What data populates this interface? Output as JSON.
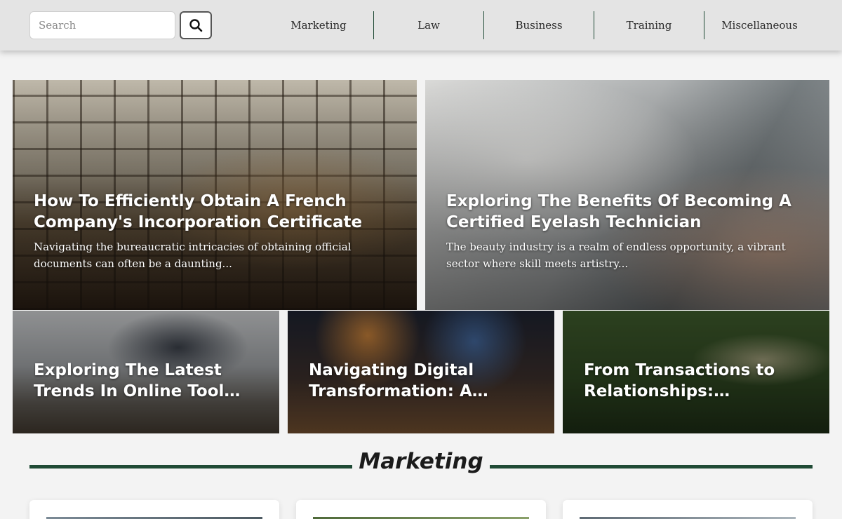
{
  "header": {
    "search": {
      "placeholder": "Search",
      "value": ""
    },
    "nav": [
      "Marketing",
      "Law",
      "Business",
      "Training",
      "Miscellaneous"
    ]
  },
  "featured": [
    {
      "title": "How To Efficiently Obtain A French Company's Incorporation Certificate",
      "excerpt": "Navigating the bureaucratic intricacies of obtaining official documents can often be a daunting..."
    },
    {
      "title": "Exploring The Benefits Of Becoming A Certified Eyelash Technician",
      "excerpt": "The beauty industry is a realm of endless opportunity, a vibrant sector where skill meets artistry..."
    }
  ],
  "secondary": [
    {
      "title": "Exploring The Latest Trends In Online Tool Enhancements"
    },
    {
      "title": "Navigating Digital Transformation: A Roadmap"
    },
    {
      "title": "From Transactions to Relationships: Rethinking"
    }
  ],
  "section": {
    "title": "Marketing"
  },
  "colors": {
    "accent": "#1f4a35",
    "header_bg": "#e4e4e4",
    "page_bg": "#f3f3f3"
  },
  "icons": {
    "search_button": "search-icon"
  }
}
